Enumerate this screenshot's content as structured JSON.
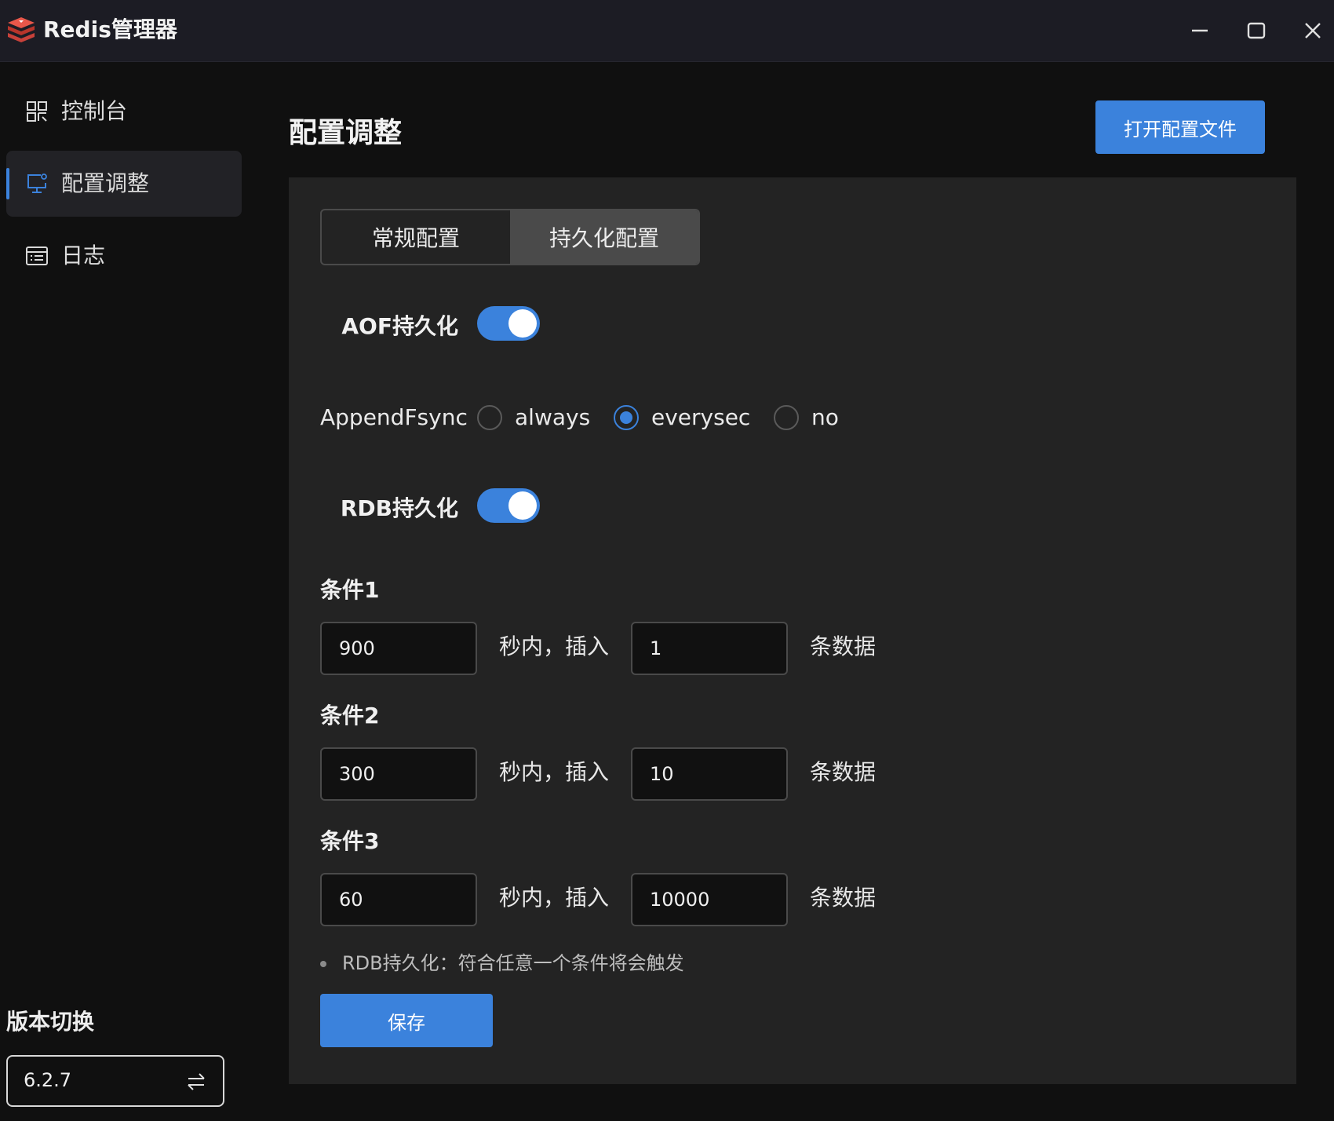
{
  "window": {
    "title": "Redis管理器",
    "controls": [
      "minimize-icon",
      "maximize-icon",
      "close-icon"
    ]
  },
  "sidebar": {
    "items": [
      {
        "label": "控制台",
        "icon": "dashboard-icon",
        "active": false
      },
      {
        "label": "配置调整",
        "icon": "monitor-settings-icon",
        "active": true
      },
      {
        "label": "日志",
        "icon": "log-list-icon",
        "active": false
      }
    ],
    "version_title": "版本切换",
    "version_value": "6.2.7",
    "version_icon": "swap-icon"
  },
  "main": {
    "title": "配置调整",
    "open_config_label": "打开配置文件",
    "tabs": [
      {
        "label": "常规配置",
        "active": false
      },
      {
        "label": "持久化配置",
        "active": true
      }
    ],
    "aof": {
      "label": "AOF持久化",
      "enabled": true
    },
    "append_fsync": {
      "label": "AppendFsync",
      "options": [
        "always",
        "everysec",
        "no"
      ],
      "selected": "everysec"
    },
    "rdb": {
      "label": "RDB持久化",
      "enabled": true
    },
    "conditions": [
      {
        "title": "条件1",
        "seconds": "900",
        "mid_text": "秒内，插入",
        "count": "1",
        "tail_text": "条数据"
      },
      {
        "title": "条件2",
        "seconds": "300",
        "mid_text": "秒内，插入",
        "count": "10",
        "tail_text": "条数据"
      },
      {
        "title": "条件3",
        "seconds": "60",
        "mid_text": "秒内，插入",
        "count": "10000",
        "tail_text": "条数据"
      }
    ],
    "hint": "RDB持久化：符合任意一个条件将会触发",
    "save_label": "保存"
  },
  "colors": {
    "accent": "#3b82dc",
    "background": "#101010",
    "panel": "#232323",
    "titlebar": "#1c1c24"
  }
}
